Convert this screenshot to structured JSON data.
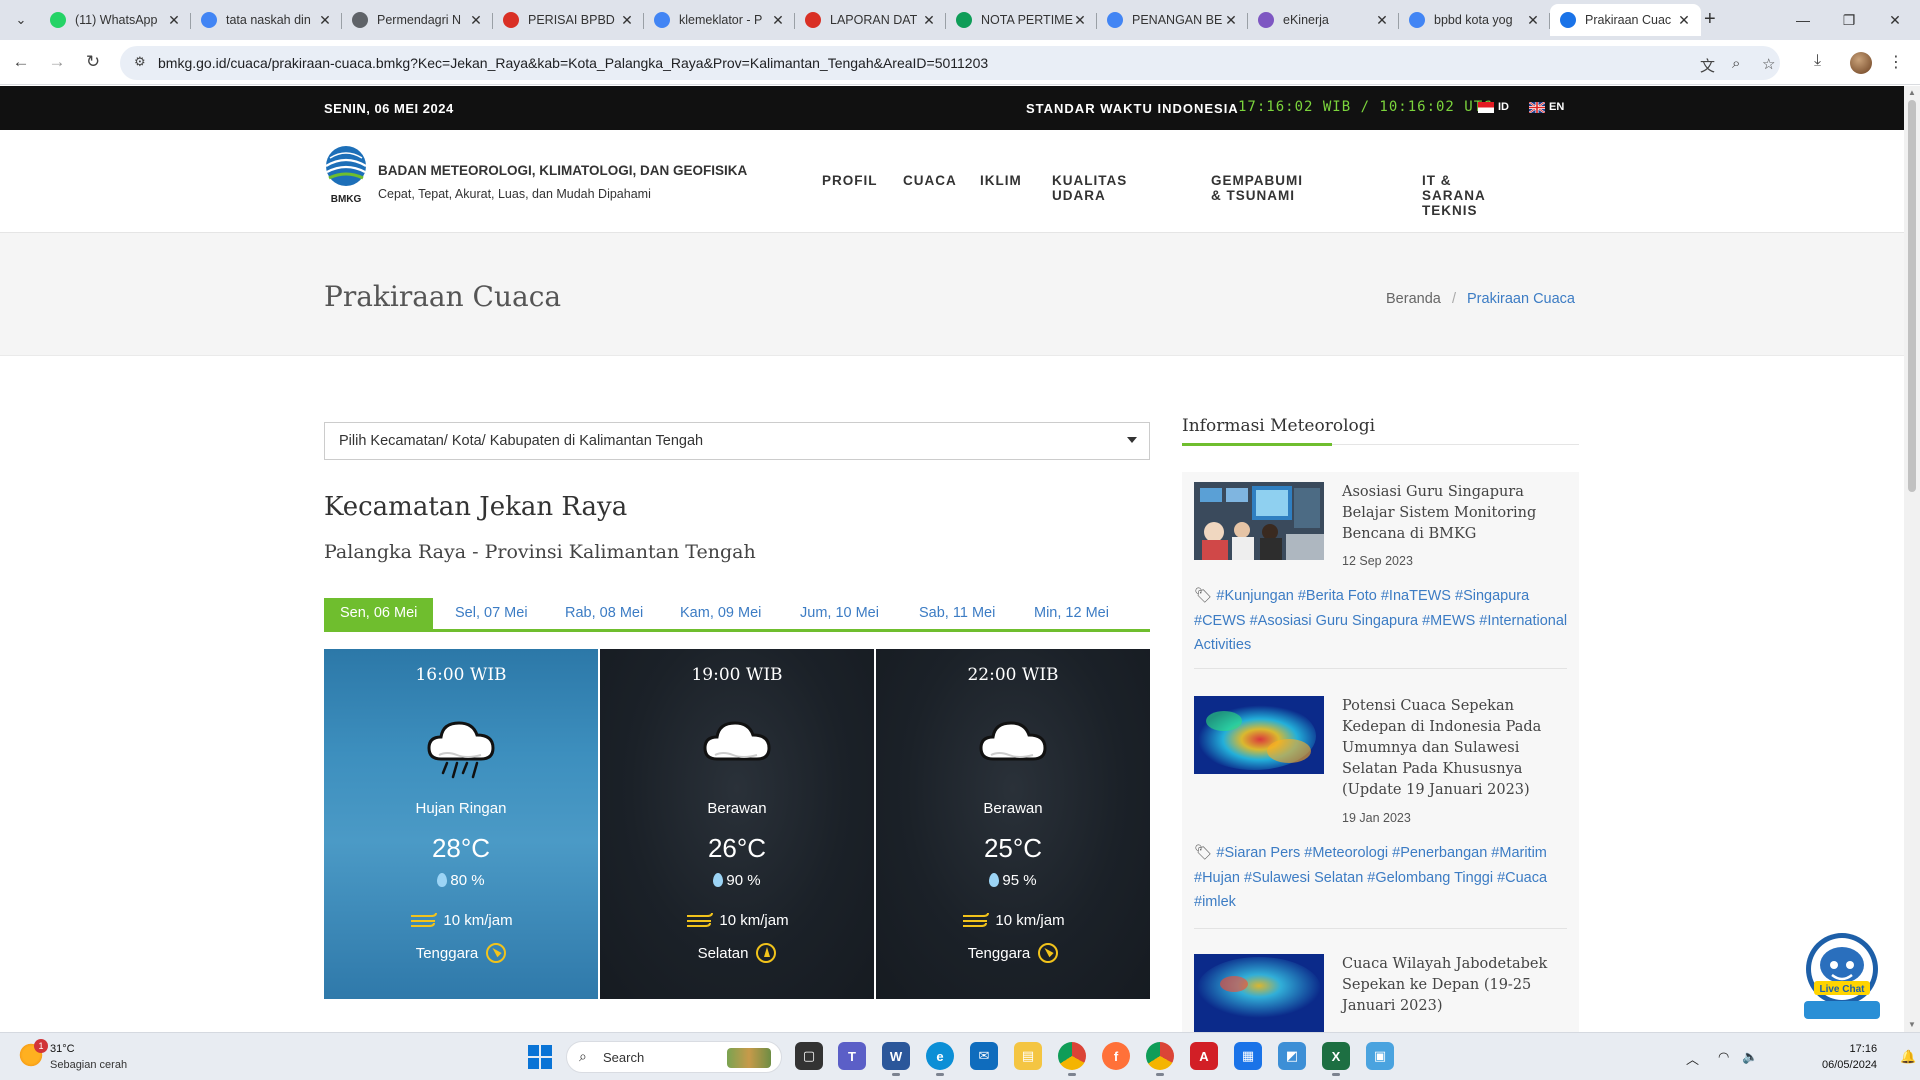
{
  "browser": {
    "tabs": [
      {
        "title": "(11) WhatsApp",
        "favicon": "whatsapp-icon",
        "color": "#25d366"
      },
      {
        "title": "tata naskah din",
        "favicon": "google-icon",
        "color": "#4285f4"
      },
      {
        "title": "Permendagri N",
        "favicon": "globe-icon",
        "color": "#5f6368"
      },
      {
        "title": "PERISAI BPBD",
        "favicon": "bpbd-icon",
        "color": "#d93025"
      },
      {
        "title": "klemeklator - P",
        "favicon": "google-icon",
        "color": "#4285f4"
      },
      {
        "title": "LAPORAN DAT",
        "favicon": "bpbd-icon",
        "color": "#d93025"
      },
      {
        "title": "NOTA PERTIME",
        "favicon": "chrome-ext-icon",
        "color": "#0f9d58"
      },
      {
        "title": "PENANGAN BE",
        "favicon": "google-icon",
        "color": "#4285f4"
      },
      {
        "title": "eKinerja",
        "favicon": "ekinerja-icon",
        "color": "#7e57c2"
      },
      {
        "title": "bpbd kota yog",
        "favicon": "google-icon",
        "color": "#4285f4"
      },
      {
        "title": "Prakiraan Cuac",
        "favicon": "bmkg-icon",
        "color": "#1a73e8"
      }
    ],
    "url": "bmkg.go.id/cuaca/prakiraan-cuaca.bmkg?Kec=Jekan_Raya&kab=Kota_Palangka_Raya&Prov=Kalimantan_Tengah&AreaID=5011203"
  },
  "topstrip": {
    "date": "SENIN, 06 MEI 2024",
    "standard_label": "STANDAR WAKTU INDONESIA",
    "clock": "17:16:02 WIB / 10:16:02 UTC",
    "lang_id": "ID",
    "lang_en": "EN"
  },
  "header": {
    "logo_text": "BMKG",
    "org": "BADAN METEOROLOGI, KLIMATOLOGI, DAN GEOFISIKA",
    "tagline": "Cepat, Tepat, Akurat, Luas, dan Mudah Dipahami",
    "nav": [
      "PROFIL",
      "CUACA",
      "IKLIM",
      "KUALITAS UDARA",
      "GEMPABUMI & TSUNAMI",
      "IT & SARANA TEKNIS"
    ]
  },
  "pagehead": {
    "title": "Prakiraan Cuaca",
    "breadcrumb_home": "Beranda",
    "breadcrumb_sep": "/",
    "breadcrumb_current": "Prakiraan Cuaca"
  },
  "forecast": {
    "select_value": "Pilih Kecamatan/ Kota/ Kabupaten di Kalimantan Tengah",
    "kecamatan": "Kecamatan Jekan Raya",
    "kabupaten": "Palangka Raya - Provinsi Kalimantan Tengah",
    "days": [
      "Sen, 06 Mei",
      "Sel, 07 Mei",
      "Rab, 08 Mei",
      "Kam, 09 Mei",
      "Jum, 10 Mei",
      "Sab, 11 Mei",
      "Min, 12 Mei"
    ],
    "cards": [
      {
        "time": "16:00 WIB",
        "condition": "Hujan Ringan",
        "icon": "light-rain-icon",
        "temp": "28°C",
        "humidity": "80 %",
        "wind": "10 km/jam",
        "direction": "Tenggara"
      },
      {
        "time": "19:00 WIB",
        "condition": "Berawan",
        "icon": "cloudy-icon",
        "temp": "26°C",
        "humidity": "90 %",
        "wind": "10 km/jam",
        "direction": "Selatan"
      },
      {
        "time": "22:00 WIB",
        "condition": "Berawan",
        "icon": "cloudy-icon",
        "temp": "25°C",
        "humidity": "95 %",
        "wind": "10 km/jam",
        "direction": "Tenggara"
      }
    ]
  },
  "sidebar": {
    "title": "Informasi Meteorologi",
    "news": [
      {
        "title": "Asosiasi Guru Singapura Belajar Sistem Monitoring Bencana di BMKG",
        "date": "12 Sep 2023",
        "tags": "#Kunjungan #Berita Foto #InaTEWS #Singapura #CEWS #Asosiasi Guru Singapura #MEWS #International Activities"
      },
      {
        "title": "Potensi Cuaca Sepekan Kedepan di Indonesia Pada Umumnya dan Sulawesi Selatan Pada Khususnya (Update 19 Januari 2023)",
        "date": "19 Jan 2023",
        "tags": "#Siaran Pers #Meteorologi #Penerbangan #Maritim #Hujan #Sulawesi Selatan #Gelombang Tinggi #Cuaca #imlek"
      },
      {
        "title": "Cuaca Wilayah Jabodetabek Sepekan ke Depan (19-25 Januari 2023)"
      }
    ],
    "livechat": "Live Chat"
  },
  "taskbar": {
    "weather_temp": "31°C",
    "weather_desc": "Sebagian cerah",
    "weather_badge": "1",
    "search_label": "Search",
    "time": "17:16",
    "date": "06/05/2024"
  },
  "colors": {
    "accent_green": "#6fbe2e",
    "link_blue": "#3c7cc4",
    "top_strip": "#111111",
    "clock_green": "#7bd43c"
  }
}
